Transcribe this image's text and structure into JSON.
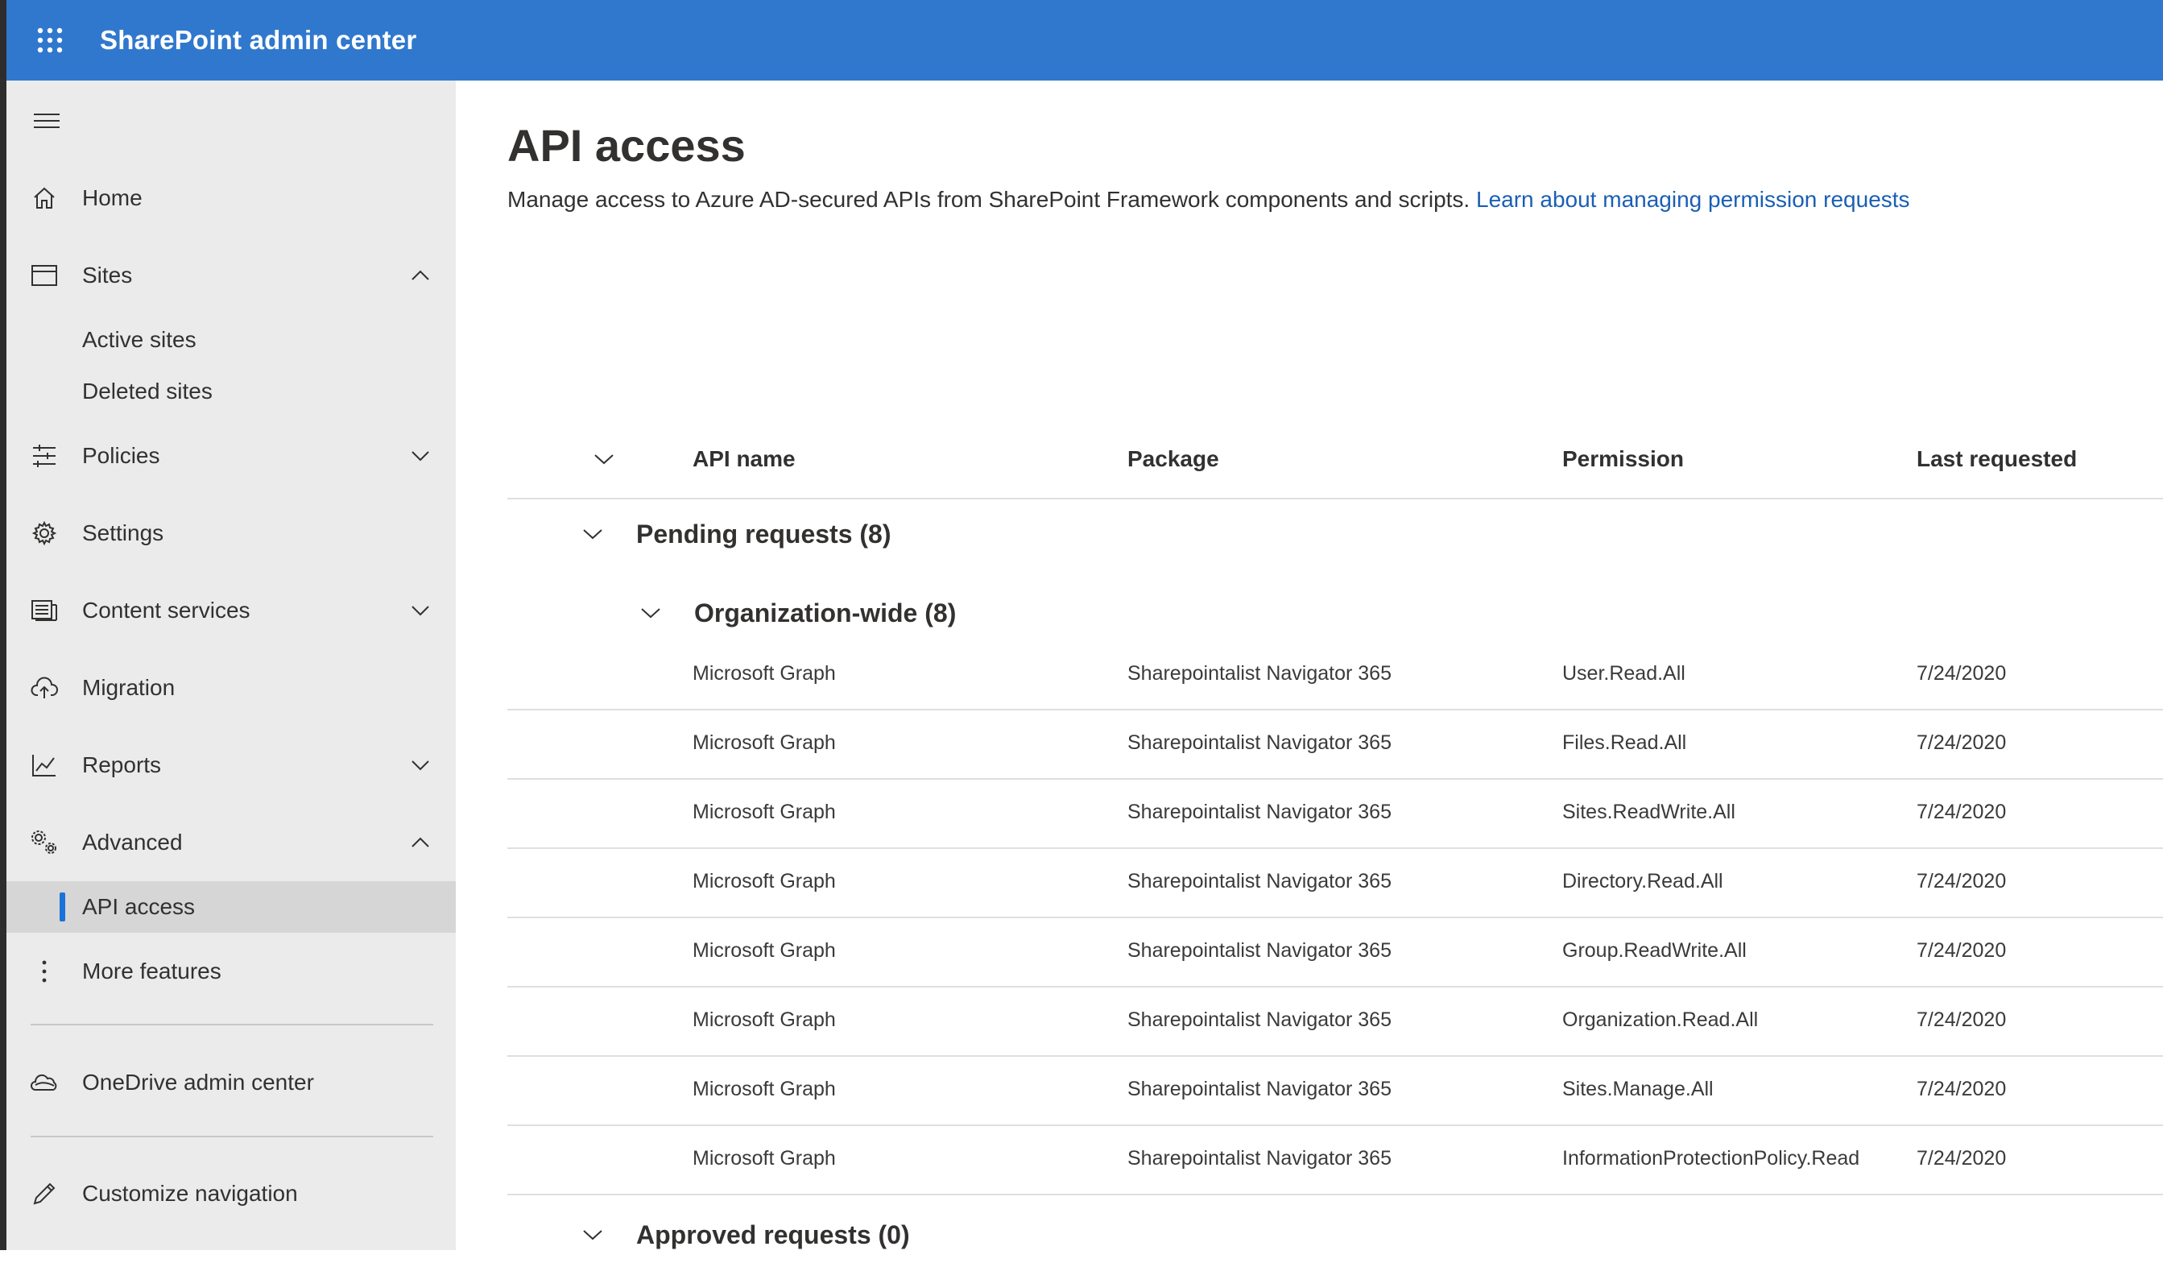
{
  "app": {
    "title": "SharePoint admin center"
  },
  "sidebar": {
    "items": [
      {
        "label": "Home",
        "icon": "home-icon"
      },
      {
        "label": "Sites",
        "icon": "sites-icon",
        "expanded": true,
        "children": [
          {
            "label": "Active sites"
          },
          {
            "label": "Deleted sites"
          }
        ]
      },
      {
        "label": "Policies",
        "icon": "policies-icon",
        "expanded": false
      },
      {
        "label": "Settings",
        "icon": "gear-icon"
      },
      {
        "label": "Content services",
        "icon": "content-services-icon",
        "expanded": false
      },
      {
        "label": "Migration",
        "icon": "cloud-upload-icon"
      },
      {
        "label": "Reports",
        "icon": "chart-icon",
        "expanded": false
      },
      {
        "label": "Advanced",
        "icon": "advanced-gears-icon",
        "expanded": true,
        "children": [
          {
            "label": "API access",
            "selected": true
          }
        ]
      },
      {
        "label": "More features",
        "icon": "more-vertical-icon"
      },
      {
        "label": "OneDrive admin center",
        "icon": "onedrive-icon"
      },
      {
        "label": "Customize navigation",
        "icon": "pencil-icon"
      }
    ]
  },
  "page": {
    "title": "API access",
    "description": "Manage access to Azure AD-secured APIs from SharePoint Framework components and scripts.",
    "learn_link": "Learn about managing permission requests"
  },
  "table": {
    "columns": [
      "API name",
      "Package",
      "Permission",
      "Last requested"
    ],
    "groups": {
      "pending": "Pending requests (8)",
      "org_wide": "Organization-wide (8)",
      "approved": "Approved requests (0)"
    },
    "rows": [
      {
        "api": "Microsoft Graph",
        "package": "Sharepointalist Navigator 365",
        "permission": "User.Read.All",
        "last": "7/24/2020"
      },
      {
        "api": "Microsoft Graph",
        "package": "Sharepointalist Navigator 365",
        "permission": "Files.Read.All",
        "last": "7/24/2020"
      },
      {
        "api": "Microsoft Graph",
        "package": "Sharepointalist Navigator 365",
        "permission": "Sites.ReadWrite.All",
        "last": "7/24/2020"
      },
      {
        "api": "Microsoft Graph",
        "package": "Sharepointalist Navigator 365",
        "permission": "Directory.Read.All",
        "last": "7/24/2020"
      },
      {
        "api": "Microsoft Graph",
        "package": "Sharepointalist Navigator 365",
        "permission": "Group.ReadWrite.All",
        "last": "7/24/2020"
      },
      {
        "api": "Microsoft Graph",
        "package": "Sharepointalist Navigator 365",
        "permission": "Organization.Read.All",
        "last": "7/24/2020"
      },
      {
        "api": "Microsoft Graph",
        "package": "Sharepointalist Navigator 365",
        "permission": "Sites.Manage.All",
        "last": "7/24/2020"
      },
      {
        "api": "Microsoft Graph",
        "package": "Sharepointalist Navigator 365",
        "permission": "InformationProtectionPolicy.Read",
        "last": "7/24/2020"
      }
    ]
  },
  "colors": {
    "topbar": "#3078cd",
    "sidebar": "#ebebeb",
    "link": "#1a5fb4",
    "selection_bar": "#1a73d9"
  }
}
